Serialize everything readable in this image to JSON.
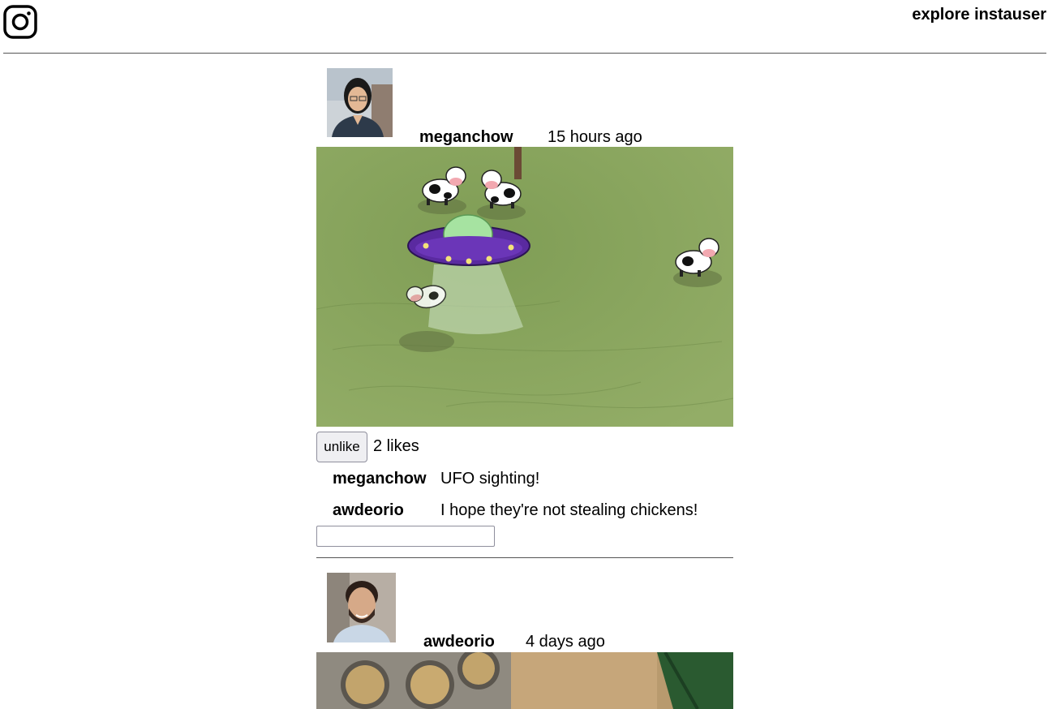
{
  "header": {
    "logo_icon": "instagram-icon",
    "explore_label": "explore",
    "user_label": "instauser"
  },
  "posts": [
    {
      "owner": "meganchow",
      "time": "15 hours ago",
      "like_button": "unlike",
      "likes": "2 likes",
      "comments": [
        {
          "owner": "meganchow",
          "text": "UFO sighting!"
        },
        {
          "owner": "awdeorio",
          "text": "I hope they're not stealing chickens!"
        }
      ],
      "comment_placeholder": ""
    },
    {
      "owner": "awdeorio",
      "time": "4 days ago"
    }
  ]
}
